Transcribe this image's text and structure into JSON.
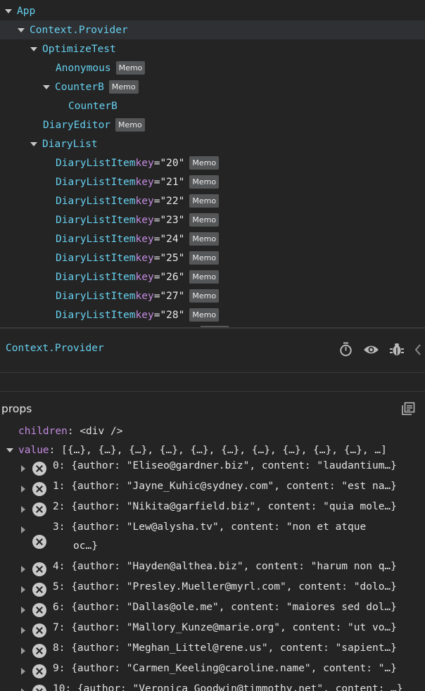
{
  "tree": {
    "items": [
      {
        "label": "App",
        "level": 0,
        "expanded": true
      },
      {
        "label": "Context.Provider",
        "level": 1,
        "expanded": true,
        "selected": true
      },
      {
        "label": "OptimizeTest",
        "level": 2,
        "expanded": true
      },
      {
        "label": "Anonymous",
        "level": 3,
        "badge": "Memo"
      },
      {
        "label": "CounterB",
        "level": 3,
        "expanded": true,
        "badge": "Memo"
      },
      {
        "label": "CounterB",
        "level": 4
      },
      {
        "label": "DiaryEditor",
        "level": 2,
        "badge": "Memo"
      },
      {
        "label": "DiaryList",
        "level": 2,
        "expanded": true
      },
      {
        "label": "DiaryListItem",
        "level": 3,
        "key_name": "key",
        "key_value": "\"20\"",
        "badge": "Memo"
      },
      {
        "label": "DiaryListItem",
        "level": 3,
        "key_name": "key",
        "key_value": "\"21\"",
        "badge": "Memo"
      },
      {
        "label": "DiaryListItem",
        "level": 3,
        "key_name": "key",
        "key_value": "\"22\"",
        "badge": "Memo"
      },
      {
        "label": "DiaryListItem",
        "level": 3,
        "key_name": "key",
        "key_value": "\"23\"",
        "badge": "Memo"
      },
      {
        "label": "DiaryListItem",
        "level": 3,
        "key_name": "key",
        "key_value": "\"24\"",
        "badge": "Memo"
      },
      {
        "label": "DiaryListItem",
        "level": 3,
        "key_name": "key",
        "key_value": "\"25\"",
        "badge": "Memo"
      },
      {
        "label": "DiaryListItem",
        "level": 3,
        "key_name": "key",
        "key_value": "\"26\"",
        "badge": "Memo"
      },
      {
        "label": "DiaryListItem",
        "level": 3,
        "key_name": "key",
        "key_value": "\"27\"",
        "badge": "Memo"
      },
      {
        "label": "DiaryListItem",
        "level": 3,
        "key_name": "key",
        "key_value": "\"28\"",
        "badge": "Memo"
      }
    ]
  },
  "header": {
    "title": "Context.Provider",
    "icons": [
      "stopwatch-icon",
      "eye-icon",
      "bug-icon",
      "source-icon"
    ]
  },
  "props": {
    "title": "props",
    "copy_icon": "copy-icon",
    "children_key": "children",
    "children_value": "<div />",
    "value_key": "value",
    "value_summary": "[{…}, {…}, {…}, {…}, {…}, {…}, {…}, {…}, {…}, {…}, …]",
    "entries": [
      {
        "index": "0",
        "text": "{author: \"Eliseo@gardner.biz\", content: \"laudantium…}"
      },
      {
        "index": "1",
        "text": "{author: \"Jayne_Kuhic@sydney.com\", content: \"est na…}"
      },
      {
        "index": "2",
        "text": "{author: \"Nikita@garfield.biz\", content: \"quia mole…}"
      },
      {
        "index": "3",
        "text": "{author: \"Lew@alysha.tv\", content: \"non et atque",
        "text2": "oc…}"
      },
      {
        "index": "4",
        "text": "{author: \"Hayden@althea.biz\", content: \"harum non q…}"
      },
      {
        "index": "5",
        "text": "{author: \"Presley.Mueller@myrl.com\", content: \"dolo…}"
      },
      {
        "index": "6",
        "text": "{author: \"Dallas@ole.me\", content: \"maiores sed dol…}"
      },
      {
        "index": "7",
        "text": "{author: \"Mallory_Kunze@marie.org\", content: \"ut vo…}"
      },
      {
        "index": "8",
        "text": "{author: \"Meghan_Littel@rene.us\", content: \"sapient…}"
      },
      {
        "index": "9",
        "text": "{author: \"Carmen_Keeling@caroline.name\", content: \"…}"
      },
      {
        "index": "10",
        "text": "{author: \"Veronica_Goodwin@timmothy.net\", content: …}"
      }
    ]
  }
}
